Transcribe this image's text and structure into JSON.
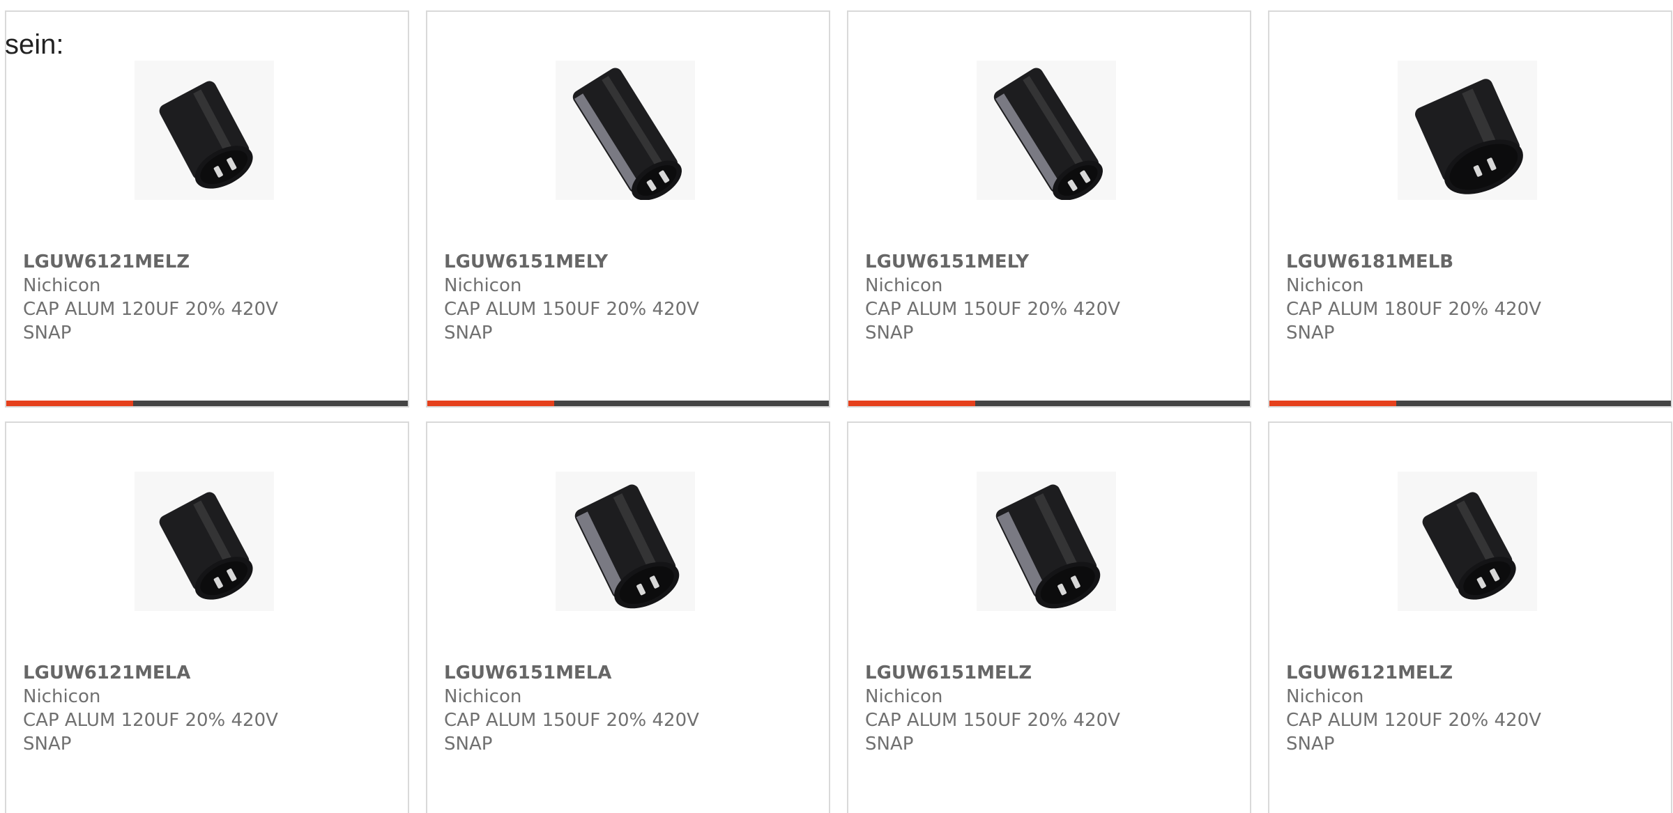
{
  "intro_text": "sein:",
  "products": [
    {
      "part_number": "LGUW6121MELZ",
      "manufacturer": "Nichicon",
      "description_line1": "CAP ALUM 120UF 20% 420V",
      "description_line2": "SNAP",
      "image": "capacitor-photo",
      "variant": "short"
    },
    {
      "part_number": "LGUW6151MELY",
      "manufacturer": "Nichicon",
      "description_line1": "CAP ALUM 150UF 20% 420V",
      "description_line2": "SNAP",
      "image": "capacitor-photo",
      "variant": "long"
    },
    {
      "part_number": "LGUW6151MELY",
      "manufacturer": "Nichicon",
      "description_line1": "CAP ALUM 150UF 20% 420V",
      "description_line2": "SNAP",
      "image": "capacitor-photo",
      "variant": "long"
    },
    {
      "part_number": "LGUW6181MELB",
      "manufacturer": "Nichicon",
      "description_line1": "CAP ALUM 180UF 20% 420V",
      "description_line2": "SNAP",
      "image": "capacitor-photo",
      "variant": "wide"
    },
    {
      "part_number": "LGUW6121MELA",
      "manufacturer": "Nichicon",
      "description_line1": "CAP ALUM 120UF 20% 420V",
      "description_line2": "SNAP",
      "image": "capacitor-photo",
      "variant": "short"
    },
    {
      "part_number": "LGUW6151MELA",
      "manufacturer": "Nichicon",
      "description_line1": "CAP ALUM 150UF 20% 420V",
      "description_line2": "SNAP",
      "image": "capacitor-photo",
      "variant": "medium"
    },
    {
      "part_number": "LGUW6151MELZ",
      "manufacturer": "Nichicon",
      "description_line1": "CAP ALUM 150UF 20% 420V",
      "description_line2": "SNAP",
      "image": "capacitor-photo",
      "variant": "medium"
    },
    {
      "part_number": "LGUW6121MELZ",
      "manufacturer": "Nichicon",
      "description_line1": "CAP ALUM 120UF 20% 420V",
      "description_line2": "SNAP",
      "image": "capacitor-photo",
      "variant": "short"
    }
  ],
  "colors": {
    "accent_orange": "#e5401c",
    "accent_dark": "#444444",
    "card_border": "#d9d9d9",
    "text": "#707070"
  }
}
